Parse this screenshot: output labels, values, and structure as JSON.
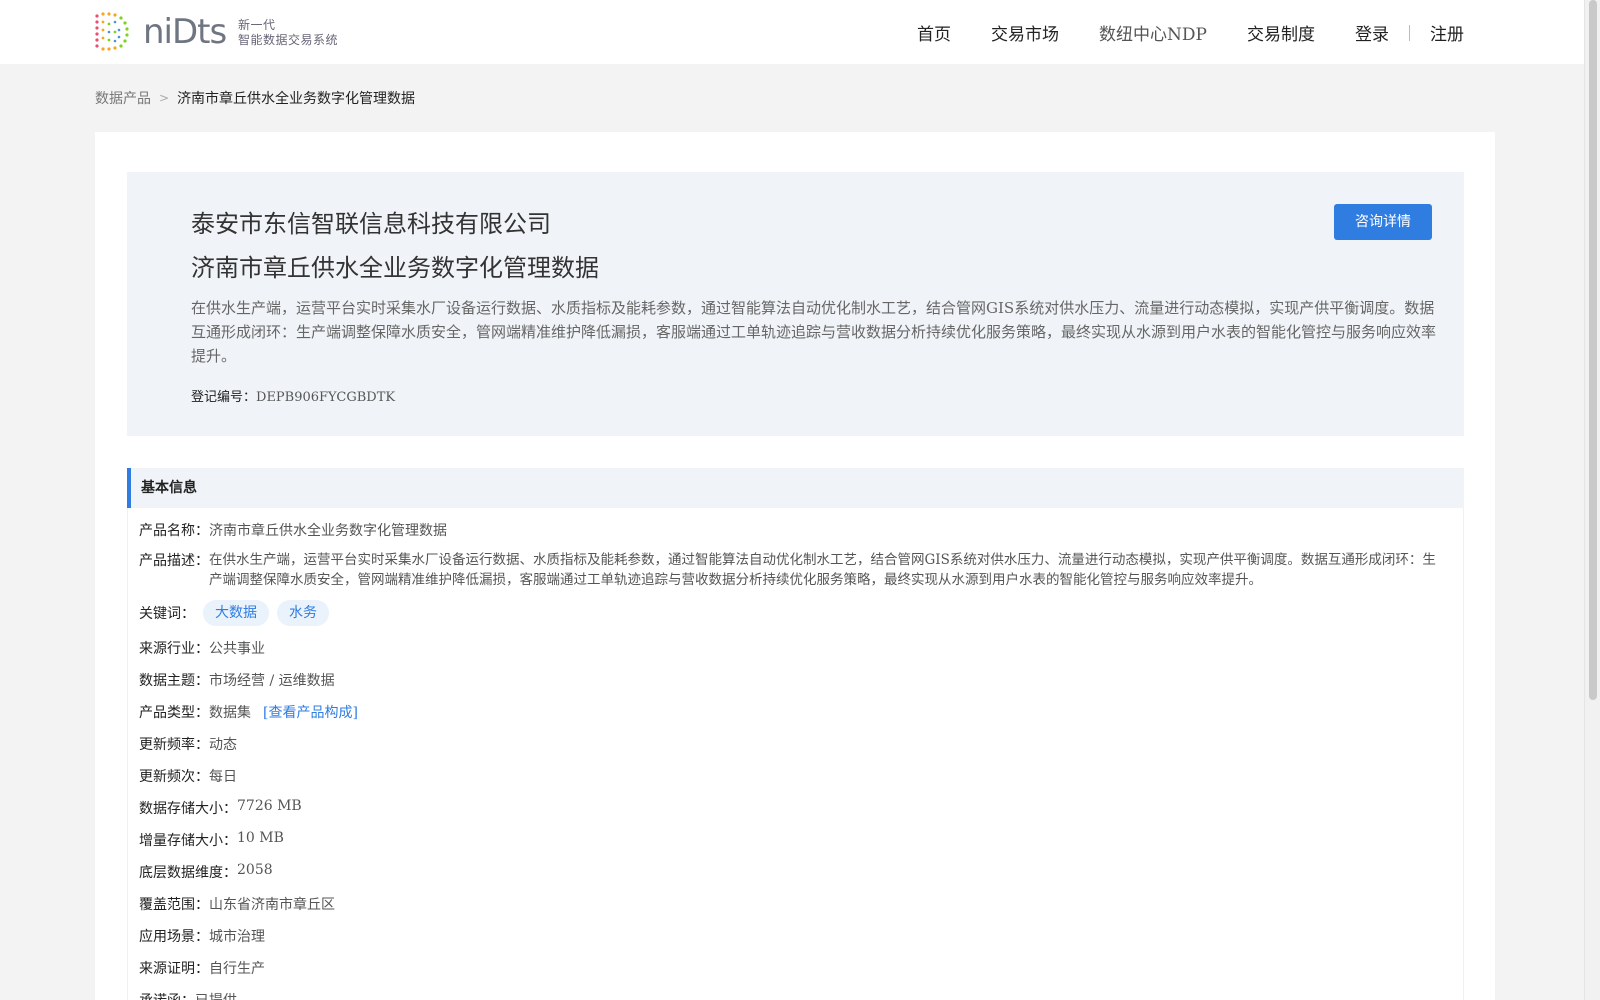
{
  "header": {
    "logo_text": "niDts",
    "logo_tagline_1": "新一代",
    "logo_tagline_2": "智能数据交易系统",
    "nav": [
      {
        "label": "首页"
      },
      {
        "label": "交易市场"
      },
      {
        "label": "数纽中心NDP"
      },
      {
        "label": "交易制度"
      }
    ],
    "login": "登录",
    "register": "注册"
  },
  "breadcrumb": {
    "root": "数据产品",
    "separator": ">",
    "current": "济南市章丘供水全业务数字化管理数据"
  },
  "hero": {
    "company": "泰安市东信智联信息科技有限公司",
    "title": "济南市章丘供水全业务数字化管理数据",
    "description": "在供水生产端，运营平台实时采集水厂设备运行数据、水质指标及能耗参数，通过智能算法自动优化制水工艺，结合管网GIS系统对供水压力、流量进行动态模拟，实现产供平衡调度。数据互通形成闭环：生产端调整保障水质安全，管网端精准维护降低漏损，客服端通过工单轨迹追踪与营收数据分析持续优化服务策略，最终实现从水源到用户水表的智能化管控与服务响应效率提升。",
    "reg_label": "登记编号：",
    "reg_value": "DEPB906FYCGBDTK",
    "consult_button": "咨询详情"
  },
  "basic_info": {
    "title": "基本信息",
    "product_name_label": "产品名称：",
    "product_name": "济南市章丘供水全业务数字化管理数据",
    "desc_label": "产品描述：",
    "desc": "在供水生产端，运营平台实时采集水厂设备运行数据、水质指标及能耗参数，通过智能算法自动优化制水工艺，结合管网GIS系统对供水压力、流量进行动态模拟，实现产供平衡调度。数据互通形成闭环：生产端调整保障水质安全，管网端精准维护降低漏损，客服端通过工单轨迹追踪与营收数据分析持续优化服务策略，最终实现从水源到用户水表的智能化管控与服务响应效率提升。",
    "keywords_label": "关键词：",
    "keywords": [
      "大数据",
      "水务"
    ],
    "industry_label": "来源行业：",
    "industry": "公共事业",
    "theme_label": "数据主题：",
    "theme": "市场经营 / 运维数据",
    "type_label": "产品类型：",
    "type": "数据集",
    "type_link": "[查看产品构成]",
    "update_freq_label": "更新频率：",
    "update_freq": "动态",
    "update_times_label": "更新频次：",
    "update_times": "每日",
    "storage_label": "数据存储大小：",
    "storage": "7726 MB",
    "increment_label": "增量存储大小：",
    "increment": "10 MB",
    "dimension_label": "底层数据维度：",
    "dimension": "2058",
    "coverage_label": "覆盖范围：",
    "coverage": "山东省济南市章丘区",
    "scenario_label": "应用场景：",
    "scenario": "城市治理",
    "source_label": "来源证明：",
    "source": "自行生产",
    "commitment_label": "承诺函：",
    "commitment": "已提供"
  }
}
